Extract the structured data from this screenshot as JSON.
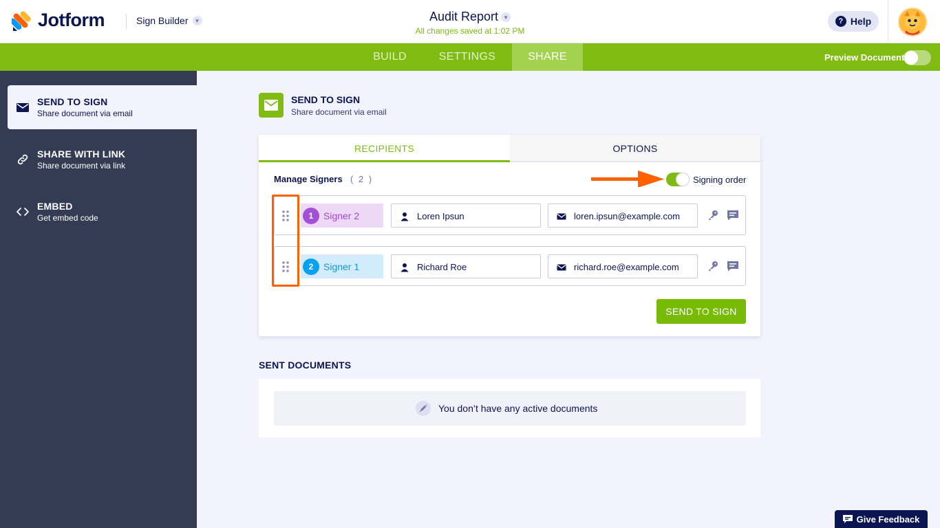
{
  "header": {
    "brand": "Jotform",
    "builder_label": "Sign Builder",
    "doc_title": "Audit Report",
    "saved_status": "All changes saved at 1:02 PM",
    "help_label": "Help"
  },
  "nav": {
    "tabs": [
      {
        "label": "BUILD"
      },
      {
        "label": "SETTINGS"
      },
      {
        "label": "SHARE",
        "active": true
      }
    ],
    "preview_label": "Preview Document",
    "preview_on": false
  },
  "sidebar": {
    "items": [
      {
        "title": "SEND TO SIGN",
        "subtitle": "Share document via email",
        "icon": "envelope-icon",
        "active": true
      },
      {
        "title": "SHARE WITH LINK",
        "subtitle": "Share document via link",
        "icon": "link-icon"
      },
      {
        "title": "EMBED",
        "subtitle": "Get embed code",
        "icon": "code-icon"
      }
    ]
  },
  "section": {
    "title": "SEND TO SIGN",
    "subtitle": "Share document via email",
    "icon": "envelope-icon"
  },
  "card": {
    "tabs": [
      {
        "label": "RECIPIENTS",
        "active": true
      },
      {
        "label": "OPTIONS"
      }
    ],
    "manage_label": "Manage Signers",
    "signer_count": "( 2 )",
    "signing_order_label": "Signing order",
    "signing_order_on": true,
    "signers": [
      {
        "order": "1",
        "label": "Signer 2",
        "name": "Loren Ipsun",
        "email": "loren.ipsun@example.com",
        "color": "#a34fd6",
        "bg": "#edd9f7",
        "text_color": "#9c4bd0"
      },
      {
        "order": "2",
        "label": "Signer 1",
        "name": "Richard Roe",
        "email": "richard.roe@example.com",
        "color": "#09a0f2",
        "bg": "#d3ecfb",
        "text_color": "#1596e0"
      }
    ],
    "send_button": "SEND TO SIGN"
  },
  "sent": {
    "title": "SENT DOCUMENTS",
    "empty_text": "You don’t have any active documents"
  },
  "feedback_label": "Give Feedback",
  "colors": {
    "brand_green": "#7fbb12",
    "navy": "#0a1551",
    "sidebar_bg": "#343c54",
    "annotation_orange": "#ff6100"
  }
}
